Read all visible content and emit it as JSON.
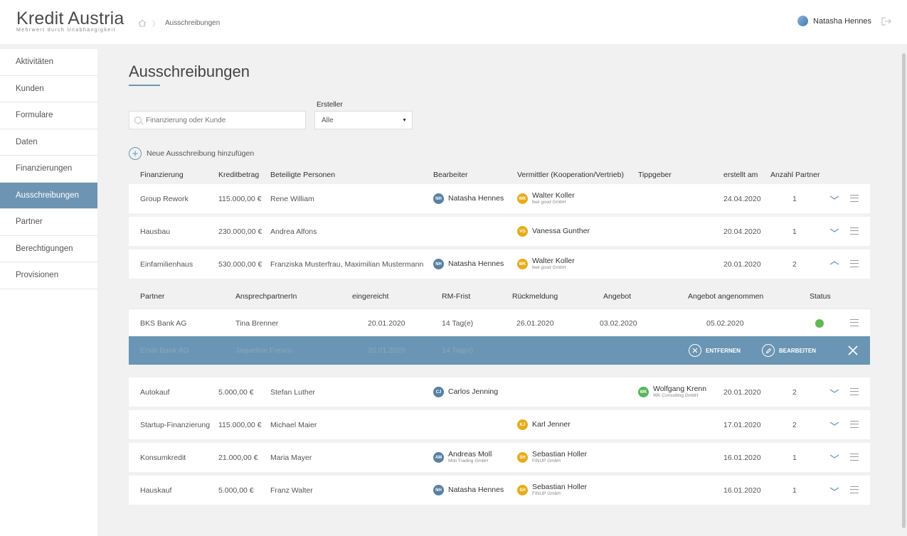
{
  "brand": {
    "title": "Kredit Austria",
    "subtitle": "Mehrwert durch Unabhängigkeit"
  },
  "breadcrumb": {
    "current": "Ausschreibungen"
  },
  "user": {
    "name": "Natasha Hennes"
  },
  "sidebar": {
    "items": [
      {
        "label": "Aktivitäten"
      },
      {
        "label": "Kunden"
      },
      {
        "label": "Formulare"
      },
      {
        "label": "Daten"
      },
      {
        "label": "Finanzierungen"
      },
      {
        "label": "Ausschreibungen"
      },
      {
        "label": "Partner"
      },
      {
        "label": "Berechtigungen"
      },
      {
        "label": "Provisionen"
      }
    ]
  },
  "page": {
    "title": "Ausschreibungen"
  },
  "filters": {
    "search_placeholder": "Finanzierung oder Kunde",
    "ersteller_label": "Ersteller",
    "ersteller_value": "Alle"
  },
  "add_label": "Neue Ausschreibung hinzufügen",
  "columns": [
    "Finanzierung",
    "Kreditbetrag",
    "Beteiligte Personen",
    "Bearbeiter",
    "Vermittler (Kooperation/Vertrieb)",
    "Tippgeber",
    "erstellt am",
    "Anzahl Partner"
  ],
  "rows": [
    {
      "fin": "Group Rework",
      "amount": "115.000,00 €",
      "persons": "Rene William",
      "b_init": "NH",
      "b_name": "Natasha Hennes",
      "b_sub": "",
      "v_init": "WK",
      "v_name": "Walter Koller",
      "v_sub": "feel good GmbH",
      "t_init": "",
      "t_name": "",
      "t_sub": "",
      "date": "24.04.2020",
      "count": "1"
    },
    {
      "fin": "Hausbau",
      "amount": "230.000,00 €",
      "persons": "Andrea Alfons",
      "b_init": "",
      "b_name": "",
      "b_sub": "",
      "v_init": "VG",
      "v_name": "Vanessa Gunther",
      "v_sub": "",
      "t_init": "",
      "t_name": "",
      "t_sub": "",
      "date": "20.04.2020",
      "count": "1"
    },
    {
      "fin": "Einfamilienhaus",
      "amount": "530.000,00 €",
      "persons": "Franziska Musterfrau, Maximilian Mustermann",
      "b_init": "NH",
      "b_name": "Natasha Hennes",
      "b_sub": "",
      "v_init": "WK",
      "v_name": "Walter Koller",
      "v_sub": "feel good GmbH",
      "t_init": "",
      "t_name": "",
      "t_sub": "",
      "date": "20.01.2020",
      "count": "2"
    },
    {
      "fin": "Autokauf",
      "amount": "5.000,00 €",
      "persons": "Stefan Luther",
      "b_init": "CJ",
      "b_name": "Carlos Jenning",
      "b_sub": "",
      "v_init": "",
      "v_name": "",
      "v_sub": "",
      "t_init": "WK",
      "t_name": "Wolfgang Krenn",
      "t_sub": "WK Consulting GmbH",
      "date": "20.01.2020",
      "count": "2"
    },
    {
      "fin": "Startup-Finanzierung",
      "amount": "115.000,00 €",
      "persons": "Michael Maier",
      "b_init": "",
      "b_name": "",
      "b_sub": "",
      "v_init": "KJ",
      "v_name": "Karl Jenner",
      "v_sub": "",
      "t_init": "",
      "t_name": "",
      "t_sub": "",
      "date": "17.01.2020",
      "count": "2"
    },
    {
      "fin": "Konsumkredit",
      "amount": "21.000,00 €",
      "persons": "Maria Mayer",
      "b_init": "AM",
      "b_name": "Andreas Moll",
      "b_sub": "Moll Trading GmbH",
      "v_init": "SH",
      "v_name": "Sebastian Holler",
      "v_sub": "FINUP GmbH",
      "t_init": "",
      "t_name": "",
      "t_sub": "",
      "date": "16.01.2020",
      "count": "1"
    },
    {
      "fin": "Hauskauf",
      "amount": "5.000,00 €",
      "persons": "Franz Walter",
      "b_init": "NH",
      "b_name": "Natasha Hennes",
      "b_sub": "",
      "v_init": "SH",
      "v_name": "Sebastian Holler",
      "v_sub": "FINUP GmbH",
      "t_init": "",
      "t_name": "",
      "t_sub": "",
      "date": "16.01.2020",
      "count": "1"
    }
  ],
  "sub_columns": [
    "Partner",
    "AnsprechpartnerIn",
    "eingereicht",
    "RM-Frist",
    "Rückmeldung",
    "Angebot",
    "Angebot angenommen",
    "Status"
  ],
  "sub_rows": [
    {
      "partner": "BKS Bank AG",
      "contact": "Tina Brenner",
      "submitted": "20.01.2020",
      "deadline": "14 Tag(e)",
      "response": "26.01.2020",
      "offer": "03.02.2020",
      "accepted": "05.02.2020",
      "status_color": "#63b855"
    },
    {
      "partner": "Erste Bank AG",
      "contact": "Jaqueline Fresco",
      "submitted": "20.01.2020",
      "deadline": "14 Tag(e)"
    }
  ],
  "row_actions": {
    "remove": "ENTFERNEN",
    "edit": "BEARBEITEN"
  },
  "colors": {
    "accent": "#6d95b3",
    "avatar_blue": "#5880a2",
    "avatar_orange": "#e6ac1c",
    "avatar_green": "#5ab55a"
  }
}
